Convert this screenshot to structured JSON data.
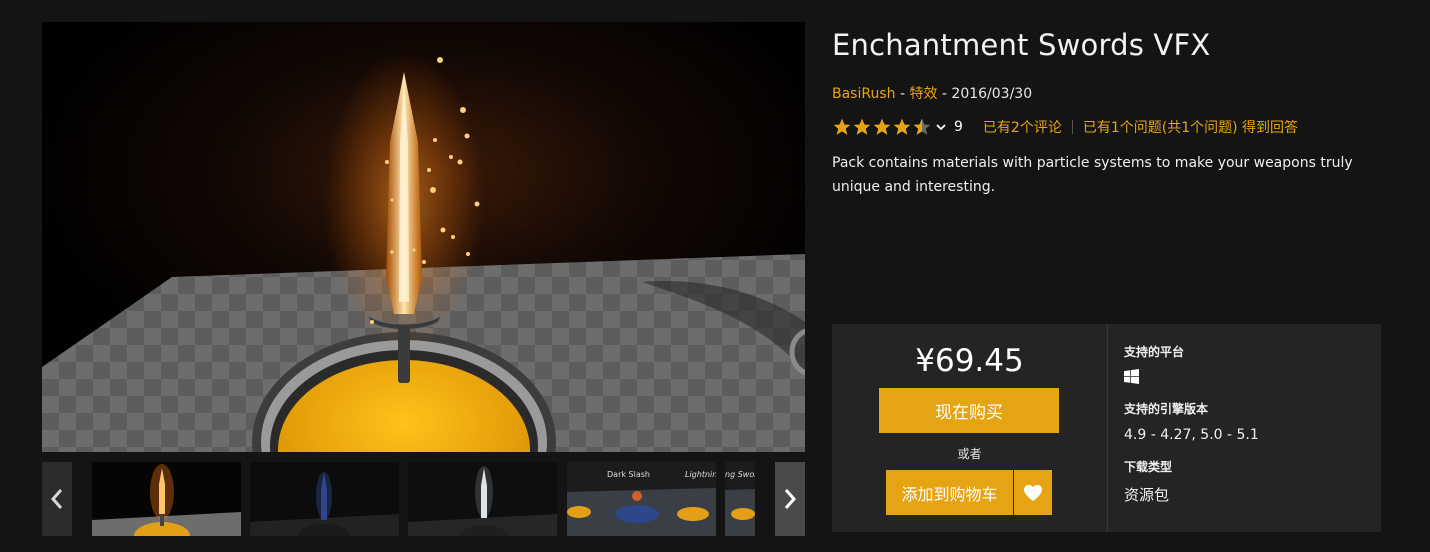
{
  "product": {
    "title": "Enchantment Swords VFX",
    "seller": "BasiRush",
    "separator1": " - ",
    "category": "特效",
    "separator2": " - ",
    "date": "2016/03/30",
    "rating": 4.5,
    "rating_count": "9",
    "reviews_link": "已有2个评论",
    "questions_link": "已有1个问题(共1个问题) 得到回答",
    "description": "Pack contains materials with particle systems to make your weapons truly unique and interesting."
  },
  "gallery": {
    "thumbnails": [
      {
        "name": "thumbnail-1-sword-fire",
        "selected": true
      },
      {
        "name": "thumbnail-2-dark-sword"
      },
      {
        "name": "thumbnail-3-light-sword"
      },
      {
        "name": "thumbnail-4-overview",
        "labels": [
          "Dark Slash",
          "Lightnin"
        ]
      },
      {
        "name": "thumbnail-5-overview",
        "labels": [
          "ng Swor"
        ]
      }
    ],
    "prev_icon": "chevron-left-icon",
    "next_icon": "chevron-right-icon"
  },
  "purchase": {
    "price": "¥69.45",
    "buy_now": "现在购买",
    "or": "或者",
    "add_to_cart": "添加到购物车",
    "wishlist_icon": "heart-icon"
  },
  "specs": {
    "platforms_heading": "支持的平台",
    "platform_icon": "windows-icon",
    "engine_heading": "支持的引擎版本",
    "engine_versions": "4.9 - 4.27, 5.0 - 5.1",
    "download_type_heading": "下载类型",
    "download_type": "资源包"
  },
  "colors": {
    "accent": "#e5a413",
    "link": "#e8a411",
    "background": "#141414",
    "panel": "#242424"
  }
}
